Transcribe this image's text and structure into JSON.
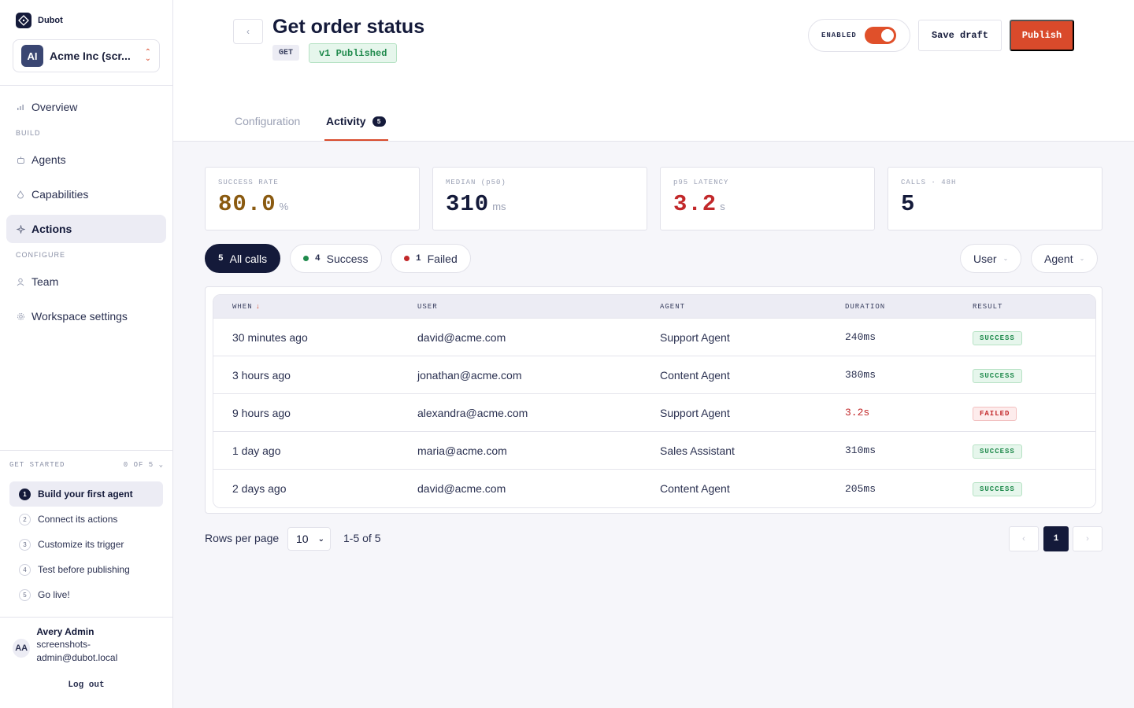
{
  "brand": {
    "name": "Dubot"
  },
  "workspace": {
    "initials": "AI",
    "name": "Acme Inc (scr..."
  },
  "nav": {
    "overview": "Overview",
    "section_build": "BUILD",
    "agents": "Agents",
    "capabilities": "Capabilities",
    "actions": "Actions",
    "section_configure": "CONFIGURE",
    "team": "Team",
    "workspace_settings": "Workspace settings"
  },
  "get_started": {
    "title": "GET STARTED",
    "progress": "0 OF 5",
    "steps": [
      {
        "num": "1",
        "label": "Build your first agent"
      },
      {
        "num": "2",
        "label": "Connect its actions"
      },
      {
        "num": "3",
        "label": "Customize its trigger"
      },
      {
        "num": "4",
        "label": "Test before publishing"
      },
      {
        "num": "5",
        "label": "Go live!"
      }
    ]
  },
  "user": {
    "initials": "AA",
    "name": "Avery Admin",
    "email": "screenshots-admin@dubot.local",
    "logout": "Log out"
  },
  "header": {
    "back_icon": "chevron-left-icon",
    "title": "Get order status",
    "method": "GET",
    "version": "v1 Published",
    "toggle_label": "ENABLED",
    "toggle_on": true,
    "save_draft": "Save draft",
    "publish": "Publish"
  },
  "tabs": [
    {
      "label": "Configuration"
    },
    {
      "label": "Activity",
      "count": "5"
    }
  ],
  "stats": [
    {
      "label": "SUCCESS RATE",
      "value": "80.0",
      "unit": "%",
      "color": "#8a5a10"
    },
    {
      "label": "MEDIAN (p50)",
      "value": "310",
      "unit": "ms",
      "color": "#141a3a"
    },
    {
      "label": "p95 LATENCY",
      "value": "3.2",
      "unit": "s",
      "color": "#c2282a"
    },
    {
      "label": "CALLS · 48H",
      "value": "5",
      "unit": "",
      "color": "#141a3a"
    }
  ],
  "filters": {
    "all": {
      "count": "5",
      "label": "All calls"
    },
    "success": {
      "count": "4",
      "label": "Success",
      "color": "#1f8a4c"
    },
    "failed": {
      "count": "1",
      "label": "Failed",
      "color": "#c2282a"
    },
    "user_dropdown": "User",
    "agent_dropdown": "Agent"
  },
  "table": {
    "headers": {
      "when": "WHEN",
      "user": "USER",
      "agent": "AGENT",
      "duration": "DURATION",
      "result": "RESULT"
    },
    "rows": [
      {
        "when": "30 minutes ago",
        "user": "david@acme.com",
        "agent": "Support Agent",
        "duration": "240ms",
        "result": "SUCCESS"
      },
      {
        "when": "3 hours ago",
        "user": "jonathan@acme.com",
        "agent": "Content Agent",
        "duration": "380ms",
        "result": "SUCCESS"
      },
      {
        "when": "9 hours ago",
        "user": "alexandra@acme.com",
        "agent": "Support Agent",
        "duration": "3.2s",
        "result": "FAILED"
      },
      {
        "when": "1 day ago",
        "user": "maria@acme.com",
        "agent": "Sales Assistant",
        "duration": "310ms",
        "result": "SUCCESS"
      },
      {
        "when": "2 days ago",
        "user": "david@acme.com",
        "agent": "Content Agent",
        "duration": "205ms",
        "result": "SUCCESS"
      }
    ]
  },
  "pagination": {
    "rows_label": "Rows per page",
    "rows_value": "10",
    "range": "1-5 of 5",
    "page": "1"
  }
}
